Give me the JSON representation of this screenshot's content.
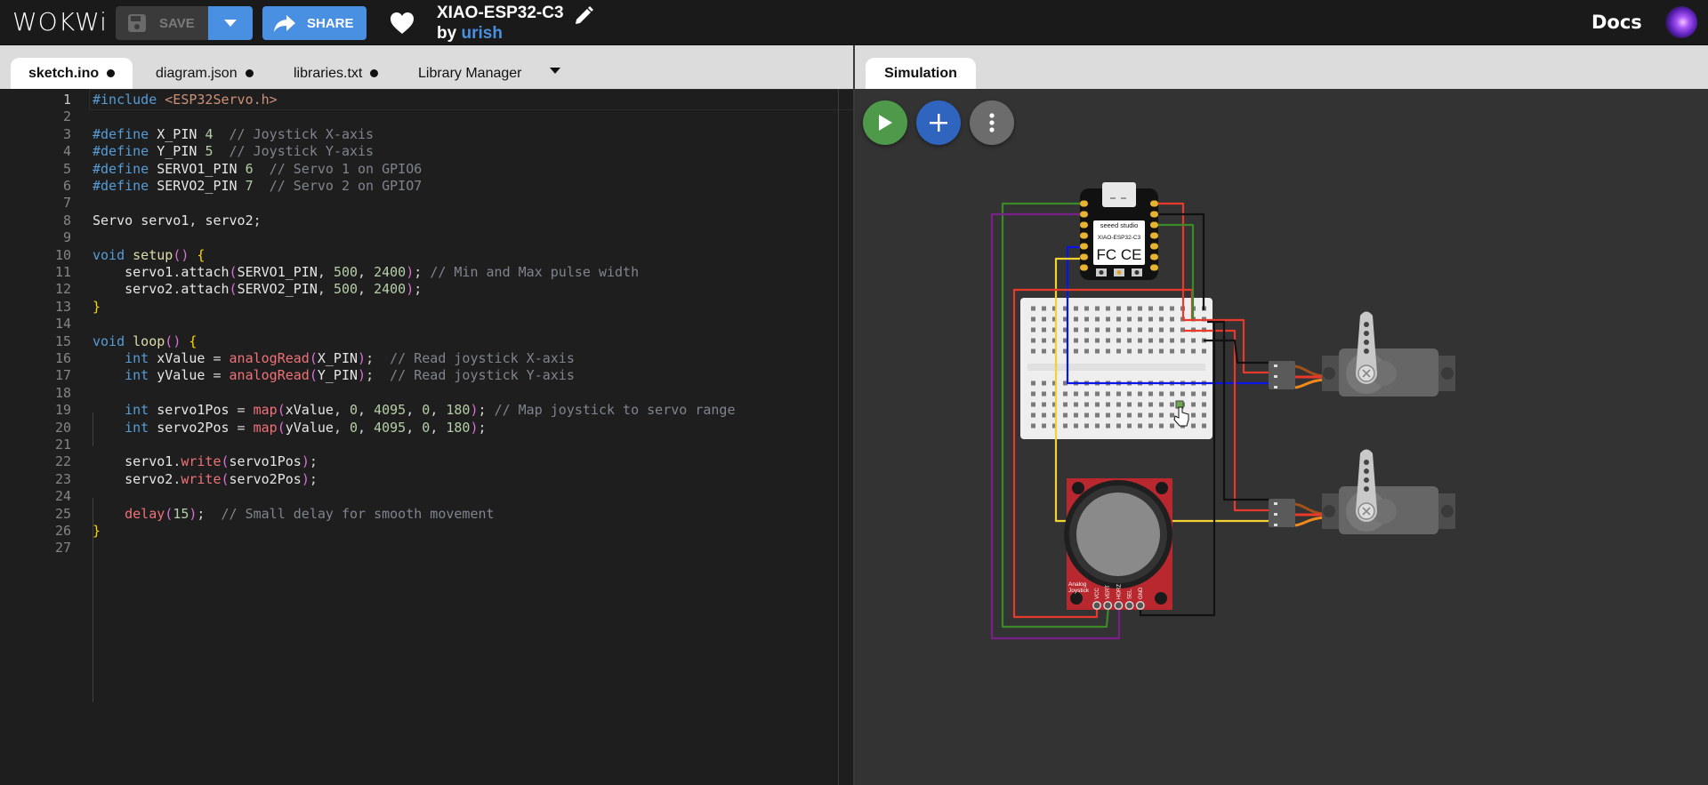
{
  "header": {
    "logo": "WOKWi",
    "save_label": "SAVE",
    "share_label": "SHARE",
    "project_title": "XIAO-ESP32-C3",
    "by_label": "by",
    "author": "urish",
    "docs_label": "Docs",
    "icons": {
      "save": "floppy-disk-icon",
      "dropdown": "chevron-down-icon",
      "share": "share-arrow-icon",
      "like": "heart-icon",
      "edit": "pencil-icon",
      "avatar": "galaxy-avatar"
    }
  },
  "editor_tabs": [
    {
      "label": "sketch.ino",
      "modified": true,
      "active": true
    },
    {
      "label": "diagram.json",
      "modified": true,
      "active": false
    },
    {
      "label": "libraries.txt",
      "modified": true,
      "active": false
    },
    {
      "label": "Library Manager",
      "modified": false,
      "active": false
    }
  ],
  "code": {
    "active_line": 1,
    "lines": [
      "#include <ESP32Servo.h>",
      "",
      "#define X_PIN 4  // Joystick X-axis",
      "#define Y_PIN 5  // Joystick Y-axis",
      "#define SERVO1_PIN 6  // Servo 1 on GPIO6",
      "#define SERVO2_PIN 7  // Servo 2 on GPIO7",
      "",
      "Servo servo1, servo2;",
      "",
      "void setup() {",
      "    servo1.attach(SERVO1_PIN, 500, 2400); // Min and Max pulse width",
      "    servo2.attach(SERVO2_PIN, 500, 2400);",
      "}",
      "",
      "void loop() {",
      "    int xValue = analogRead(X_PIN);  // Read joystick X-axis",
      "    int yValue = analogRead(Y_PIN);  // Read joystick Y-axis",
      "",
      "    int servo1Pos = map(xValue, 0, 4095, 0, 180); // Map joystick to servo range",
      "    int servo2Pos = map(yValue, 0, 4095, 0, 180);",
      "",
      "    servo1.write(servo1Pos);",
      "    servo2.write(servo2Pos);",
      "",
      "    delay(15);  // Small delay for smooth movement",
      "}",
      ""
    ]
  },
  "simulation": {
    "tab_label": "Simulation",
    "buttons": [
      {
        "name": "start-simulation",
        "icon": "play-icon"
      },
      {
        "name": "add-part",
        "icon": "plus-icon"
      },
      {
        "name": "more-options",
        "icon": "vertical-dots-icon"
      }
    ],
    "board": {
      "brand": "seeed studio",
      "model": "XIAO-ESP32-C3",
      "marks": "FC CE"
    },
    "joystick": {
      "label_line1": "Analog",
      "label_line2": "Joystick",
      "pins": [
        "VCC",
        "VERT",
        "HORZ",
        "SEL",
        "GND"
      ]
    },
    "servos": [
      "servo1",
      "servo2"
    ],
    "wire_colors": {
      "red": "#e8392a",
      "black": "#111111",
      "green": "#3a8a2a",
      "purple": "#7b1f8a",
      "blue": "#0a16e6",
      "yellow": "#f2d233"
    }
  }
}
